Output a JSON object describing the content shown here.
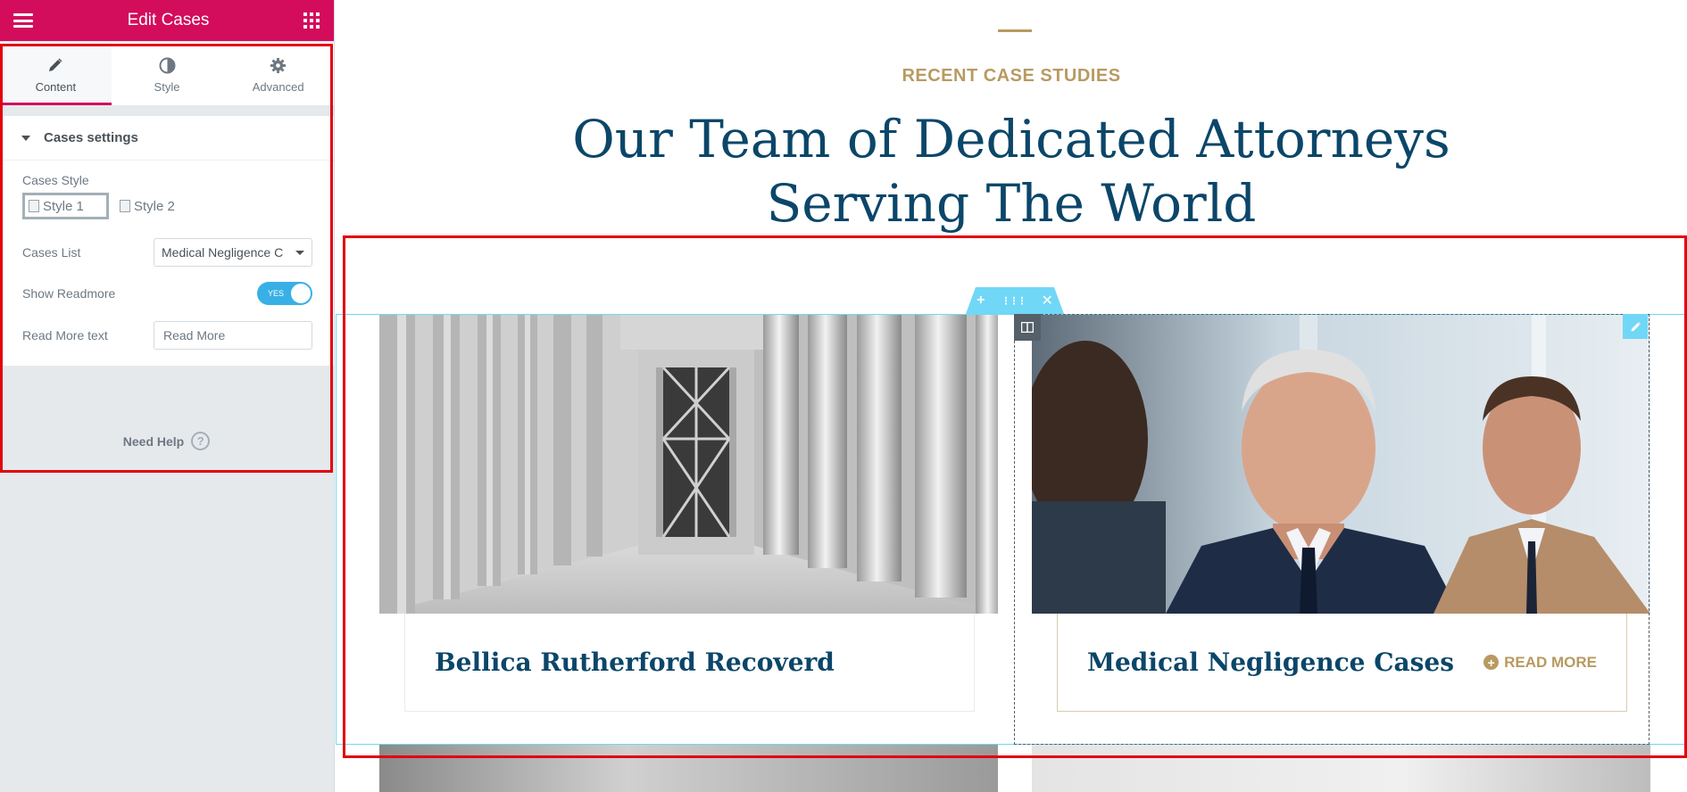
{
  "panel": {
    "title": "Edit Cases",
    "tabs": [
      {
        "label": "Content",
        "icon": "pencil-icon"
      },
      {
        "label": "Style",
        "icon": "contrast-icon"
      },
      {
        "label": "Advanced",
        "icon": "gear-icon"
      }
    ],
    "section_title": "Cases settings",
    "cases_style_label": "Cases Style",
    "style_options": [
      "Style 1",
      "Style 2"
    ],
    "cases_list_label": "Cases List",
    "cases_list_value": "Medical Negligence C",
    "show_readmore_label": "Show Readmore",
    "show_readmore_toggle": "YES",
    "read_more_text_label": "Read More text",
    "read_more_text_value": "Read More",
    "need_help": "Need Help",
    "help_icon_glyph": "?"
  },
  "preview": {
    "subtitle": "RECENT CASE STUDIES",
    "heading_line1": "Our Team of Dedicated Attorneys",
    "heading_line2": "Serving The World",
    "toolbar": {
      "add": "+",
      "move": "⋮⋮⋮",
      "close": "✕"
    },
    "cards": [
      {
        "title": "Bellica Rutherford Recoverd",
        "image": "courthouse-columns"
      },
      {
        "title": "Medical Negligence Cases",
        "image": "business-meeting",
        "read_more": "READ MORE"
      }
    ]
  },
  "colors": {
    "elementor_pink": "#d30c5c",
    "accent_gold": "#b89a61",
    "heading_navy": "#0b4669",
    "editor_blue": "#71d7f7",
    "annotation_red": "#e3000f"
  }
}
